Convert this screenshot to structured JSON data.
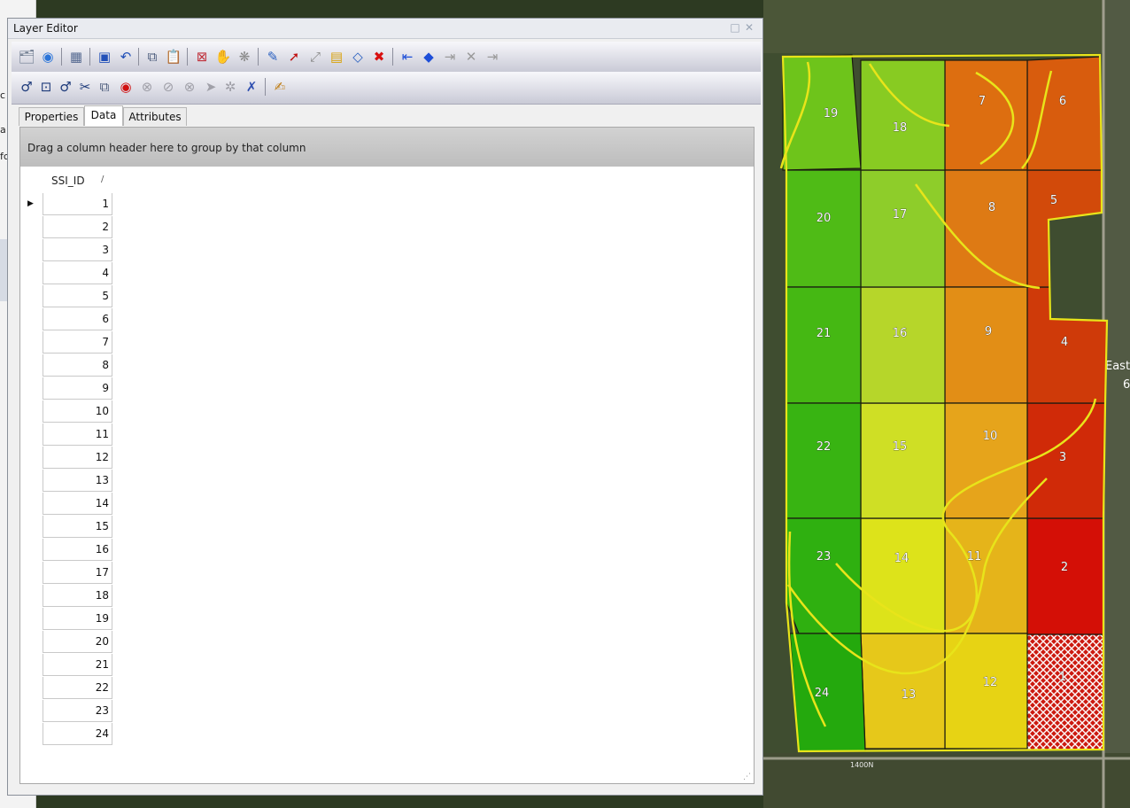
{
  "window": {
    "title": "Layer Editor"
  },
  "tabs": [
    {
      "label": "Properties",
      "active": false
    },
    {
      "label": "Data",
      "active": true
    },
    {
      "label": "Attributes",
      "active": false
    }
  ],
  "grid": {
    "group_hint": "Drag a column header here to group by that column",
    "column": "SSI_ID",
    "sort_indicator": "/",
    "selected_row_marker": "▶",
    "rows": [
      "1",
      "2",
      "3",
      "4",
      "5",
      "6",
      "7",
      "8",
      "9",
      "10",
      "11",
      "12",
      "13",
      "14",
      "15",
      "16",
      "17",
      "18",
      "19",
      "20",
      "21",
      "22",
      "23",
      "24"
    ]
  },
  "toolbar1": [
    "properties-icon",
    "help-icon",
    "table-icon",
    "save-icon",
    "undo-icon",
    "copy-icon",
    "paste-icon",
    "delete-feature-icon",
    "pan-vertices-icon",
    "merge-icon",
    "select-vertex-icon",
    "move-vertex-icon",
    "reshape-icon",
    "attribute-icon",
    "fill-icon",
    "delete-icon",
    "first-icon",
    "previous-icon",
    "next-icon",
    "clear-icon",
    "last-icon"
  ],
  "toolbar2": [
    "add-point-icon",
    "add-polygon-icon",
    "add-vertex-icon",
    "split-icon",
    "copy-geometry-icon",
    "ring-icon",
    "disabled-1-icon",
    "disabled-2-icon",
    "disabled-3-icon",
    "pointer-icon",
    "disabled-4-icon",
    "remove-icon",
    "edit-attributes-icon"
  ],
  "map": {
    "zones": [
      {
        "id": "1",
        "color": "#cc1a10",
        "hatched": true
      },
      {
        "id": "2",
        "color": "#d40f06"
      },
      {
        "id": "3",
        "color": "#d02a08"
      },
      {
        "id": "4",
        "color": "#cf3a09"
      },
      {
        "id": "5",
        "color": "#d24a0a"
      },
      {
        "id": "6",
        "color": "#d85c0d"
      },
      {
        "id": "7",
        "color": "#dd6e10"
      },
      {
        "id": "8",
        "color": "#de7a14"
      },
      {
        "id": "9",
        "color": "#e28e16"
      },
      {
        "id": "10",
        "color": "#e6a41b"
      },
      {
        "id": "11",
        "color": "#e5b41a"
      },
      {
        "id": "12",
        "color": "#e7d314"
      },
      {
        "id": "13",
        "color": "#e6c81a"
      },
      {
        "id": "14",
        "color": "#dde31a"
      },
      {
        "id": "15",
        "color": "#cfdf25"
      },
      {
        "id": "16",
        "color": "#b6d62a"
      },
      {
        "id": "17",
        "color": "#8ecd2a"
      },
      {
        "id": "18",
        "color": "#88cb22"
      },
      {
        "id": "19",
        "color": "#6ec41b"
      },
      {
        "id": "20",
        "color": "#4fbb16"
      },
      {
        "id": "21",
        "color": "#45b813"
      },
      {
        "id": "22",
        "color": "#38b412"
      },
      {
        "id": "23",
        "color": "#2fb010"
      },
      {
        "id": "24",
        "color": "#24a90d"
      }
    ],
    "labels": {
      "road": "1400N",
      "place_fragment": "East",
      "place_fragment2": "6"
    }
  },
  "background_app": {
    "fragments": [
      "c",
      "a",
      "fc"
    ]
  }
}
